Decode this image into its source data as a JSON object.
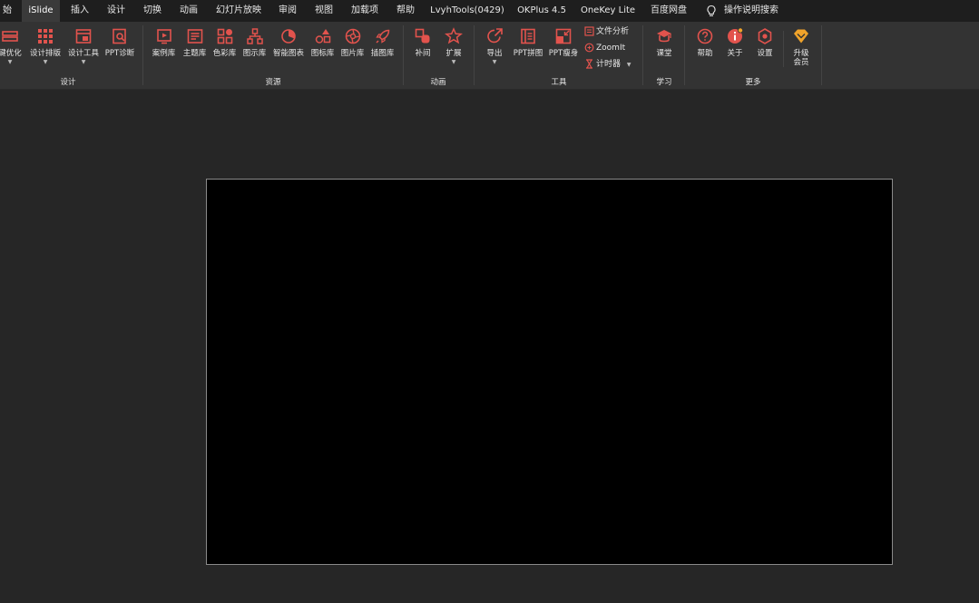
{
  "menu": {
    "items": [
      {
        "label": "始",
        "active": false
      },
      {
        "label": "iSlide",
        "active": true
      },
      {
        "label": "插入",
        "active": false
      },
      {
        "label": "设计",
        "active": false
      },
      {
        "label": "切换",
        "active": false
      },
      {
        "label": "动画",
        "active": false
      },
      {
        "label": "幻灯片放映",
        "active": false
      },
      {
        "label": "审阅",
        "active": false
      },
      {
        "label": "视图",
        "active": false
      },
      {
        "label": "加载项",
        "active": false
      },
      {
        "label": "帮助",
        "active": false
      },
      {
        "label": "LvyhTools(0429)",
        "active": false
      },
      {
        "label": "OKPlus 4.5",
        "active": false
      },
      {
        "label": "OneKey Lite",
        "active": false
      },
      {
        "label": "百度网盘",
        "active": false
      }
    ],
    "search_label": "操作说明搜索",
    "search_icon": "lightbulb-icon"
  },
  "ribbon": {
    "groups": {
      "design": "设计",
      "resources": "资源",
      "animation": "动画",
      "tools": "工具",
      "learn": "学习",
      "more": "更多"
    },
    "design": {
      "optimize": "键优化",
      "layout": "设计排版",
      "design_tools": "设计工具",
      "diagnose": "PPT诊断"
    },
    "resources": {
      "cases": "案例库",
      "themes": "主题库",
      "colors": "色彩库",
      "diagrams": "图示库",
      "smart_charts": "智能图表",
      "icons": "图标库",
      "pictures": "图片库",
      "illustrations": "插图库"
    },
    "animation": {
      "tween": "补间",
      "extend": "扩展"
    },
    "tools": {
      "export": "导出",
      "ppt_stitch": "PPT拼图",
      "ppt_slim": "PPT瘦身",
      "file_analysis": "文件分析",
      "zoomit": "ZoomIt",
      "timer": "计时器"
    },
    "learn": {
      "class": "课堂"
    },
    "more": {
      "help": "帮助",
      "about": "关于",
      "settings": "设置",
      "upgrade_line1": "升级",
      "upgrade_line2": "会员"
    }
  },
  "colors": {
    "accent": "#e2534d",
    "gold": "#f0a32a",
    "menubar_bg": "#1e1e1e",
    "ribbon_bg": "#333333",
    "workspace_bg": "#262626",
    "slide_bg": "#000000"
  }
}
